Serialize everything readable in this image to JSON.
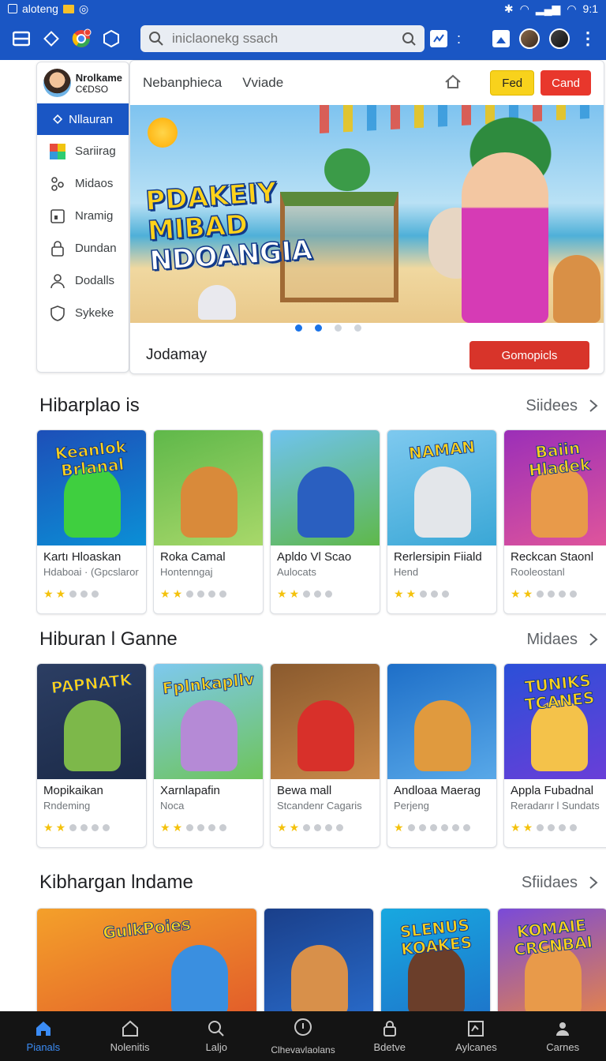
{
  "status_bar": {
    "left_text": "aloteng",
    "time": "9:1"
  },
  "app_bar": {
    "search_placeholder": "iniclaonekg ssach"
  },
  "side_panel": {
    "profile_name": "Nrolkame",
    "profile_code": "C€DSO",
    "active_item": "Nllauran",
    "items": [
      {
        "label": "Sariirag",
        "icon": "puzzle-icon"
      },
      {
        "label": "Midaos",
        "icon": "people-icon"
      },
      {
        "label": "Nramig",
        "icon": "window-icon"
      },
      {
        "label": "Dundan",
        "icon": "lock-icon"
      },
      {
        "label": "Dodalls",
        "icon": "person-icon"
      },
      {
        "label": "Sykeke",
        "icon": "shield-icon"
      }
    ]
  },
  "hero": {
    "tabs": [
      "Nebanphieca",
      "Vviade"
    ],
    "btn_yellow": "Fed",
    "btn_red": "Cand",
    "banner_title_lines": [
      "PDAKEIY",
      "MIBAD",
      "NDOANGIA"
    ],
    "slide_count": 4,
    "active_slide": 1,
    "footer_name": "Jodamay",
    "cta_label": "Gomopicls"
  },
  "sections": [
    {
      "title": "Hibarplao is",
      "more_label": "Siidees",
      "cards": [
        {
          "title": "Kartı Hloaskan",
          "subtitle": "Hdaboai · (Gpcslaror",
          "stars": 2,
          "dots": 3,
          "thumb_text": "Keanlok Brlanal",
          "bg": [
            "#1d4fb8",
            "#0b8fd6"
          ],
          "blob": "#3fcf3f"
        },
        {
          "title": "Roka Camal",
          "subtitle": "Hontenngaj",
          "stars": 2,
          "dots": 4,
          "thumb_text": "",
          "bg": [
            "#5fb84a",
            "#a8d86a"
          ],
          "blob": "#d98a3a"
        },
        {
          "title": "Apldo Vl Scao",
          "subtitle": "Aulocats",
          "stars": 2,
          "dots": 3,
          "thumb_text": "",
          "bg": [
            "#6fc3ef",
            "#5fb84a"
          ],
          "blob": "#2a5fc0"
        },
        {
          "title": "Rerlersipin Fiiald",
          "subtitle": "Hend",
          "stars": 2,
          "dots": 3,
          "thumb_text": "NAMAN",
          "bg": [
            "#7ec9ef",
            "#3aa7d6"
          ],
          "blob": "#e3e6ea"
        },
        {
          "title": "Reckcan Staonl",
          "subtitle": "Rooleostanl",
          "stars": 2,
          "dots": 4,
          "thumb_text": "Baiin Hladek",
          "bg": [
            "#9b2fb8",
            "#e0559b"
          ],
          "blob": "#e89a4a"
        }
      ]
    },
    {
      "title": "Hiburan l Ganne",
      "more_label": "Midaes",
      "cards": [
        {
          "title": "Mopikaikan",
          "subtitle": "Rndeming",
          "stars": 2,
          "dots": 4,
          "thumb_text": "PAPNATK",
          "bg": [
            "#2c3e63",
            "#1b2a48"
          ],
          "blob": "#7db84a"
        },
        {
          "title": "Xarnlapafin",
          "subtitle": "Noca",
          "stars": 2,
          "dots": 4,
          "thumb_text": "Fplnkapllv",
          "bg": [
            "#7ec9ef",
            "#6ec45a"
          ],
          "blob": "#b58ad6"
        },
        {
          "title": "Bewa mall",
          "subtitle": "Stcandenr Cagaris",
          "stars": 2,
          "dots": 4,
          "thumb_text": "",
          "bg": [
            "#8a5a2e",
            "#c98a4a"
          ],
          "blob": "#d8302a"
        },
        {
          "title": "Andloaa Maerag",
          "subtitle": "Perjeng",
          "stars": 1,
          "dots": 6,
          "thumb_text": "",
          "bg": [
            "#1e6fc8",
            "#58a8e8"
          ],
          "blob": "#e09a3e"
        },
        {
          "title": "Appla Fubadnal",
          "subtitle": "Reradarır l Sundats",
          "stars": 2,
          "dots": 4,
          "thumb_text": "TUNIKS TCANES",
          "bg": [
            "#2b4fd8",
            "#6a3ed8"
          ],
          "blob": "#f4c24a"
        }
      ]
    },
    {
      "title": "Kibhargan lndame",
      "more_label": "Sfiidaes",
      "cards": [
        {
          "wide": true,
          "thumb_text": "GulkPoies",
          "bg": [
            "#f4a02a",
            "#e0562a"
          ],
          "blob": "#3a8fe0"
        },
        {
          "thumb_text": "",
          "bg": [
            "#1a3f8a",
            "#2a6fd0"
          ],
          "blob": "#d8904a"
        },
        {
          "thumb_text": "SLENUS KOAKES",
          "bg": [
            "#18a8e0",
            "#1e6fc8"
          ],
          "blob": "#6b3e2a"
        },
        {
          "thumb_text": "KOMAIE CRCNBAI",
          "bg": [
            "#7a4ad8",
            "#f08a3a"
          ],
          "blob": "#e89a4a"
        }
      ]
    }
  ],
  "bottom_nav": [
    {
      "label": "Pianals",
      "icon": "home-icon",
      "active": true
    },
    {
      "label": "Nolenitis",
      "icon": "house-outline-icon",
      "active": false
    },
    {
      "label": "Laljo",
      "icon": "search-icon",
      "active": false
    },
    {
      "label": "Clhevavlaolans",
      "icon": "info-icon",
      "active": false
    },
    {
      "label": "Bdetve",
      "icon": "lock-icon",
      "active": false
    },
    {
      "label": "Aylcanes",
      "icon": "chart-icon",
      "active": false
    },
    {
      "label": "Carnes",
      "icon": "person-icon",
      "active": false
    }
  ],
  "colors": {
    "primary": "#1a56c4",
    "accent_red": "#d8342a",
    "accent_yellow": "#f8d21c",
    "star": "#f4c20d",
    "nav_bg": "#141414",
    "nav_active": "#3b8cf5"
  }
}
